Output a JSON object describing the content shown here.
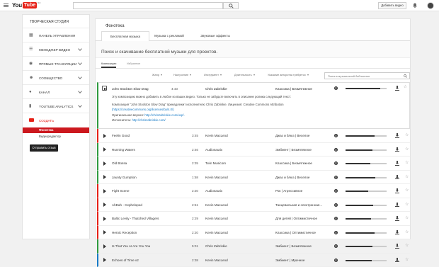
{
  "header": {
    "logo_you": "You",
    "logo_tube": "Tube",
    "logo_locale": "RU",
    "add_video": "Добавить видео"
  },
  "sidebar": {
    "title": "ТВОРЧЕСКАЯ СТУДИЯ",
    "items": [
      {
        "label": "ПАНЕЛЬ УПРАВЛЕНИЯ",
        "icon": "dashboard-icon"
      },
      {
        "label": "МЕНЕДЖЕР ВИДЕО",
        "icon": "video-manager-icon"
      },
      {
        "label": "ПРЯМЫЕ ТРАНСЛЯЦИИ",
        "icon": "live-icon"
      },
      {
        "label": "СООБЩЕСТВО",
        "icon": "community-icon"
      },
      {
        "label": "КАНАЛ",
        "icon": "channel-icon"
      },
      {
        "label": "YOUTUBE ANALYTICS",
        "icon": "analytics-icon"
      }
    ],
    "create": "СОЗДАТЬ",
    "sub_active": "Фонотека",
    "sub_other": "Видеоредактор",
    "feedback": "Отправить отзыв"
  },
  "main": {
    "title": "Фонотека",
    "tabs": [
      "Бесплатная музыка",
      "Музыка с рекламой",
      "Звуковые эффекты"
    ],
    "section_title": "Поиск и скачивание бесплатной музыки для проектов.",
    "subtabs": [
      "Композиции",
      "Избранное"
    ],
    "filters": [
      "Жанр",
      "Настроение",
      "Инструмент",
      "Длительность",
      "Указание авторства требуется"
    ],
    "search_placeholder": "Поиск в музыкальной библиотеке"
  },
  "expanded": {
    "title": "John Stockton Slow Drag",
    "duration": "4:43",
    "artist": "Chris Zabriskie",
    "genre": "Классика | Безмятежное",
    "progress": 0.85,
    "line1": "Эту композицию можно добавить в любое из ваших видео. Только не забудьте включить в описание ролика следующий текст:",
    "line2": "Композиция \"John Stockton Slow Drag\" принадлежит исполнителю Chris Zabriskie. Лицензия: Creative Commons Attribution",
    "line3_link": "(https://creativecommons.org/licenses/by/4.0/)",
    "line4_label": "Оригинальная версия:",
    "line4_link": "http://chriszabriskie.com/uvp/.",
    "line5_label": "Исполнитель:",
    "line5_link": "http://chriszabriskie.com/"
  },
  "rows": [
    {
      "title": "Feelin Good",
      "duration": "3:45",
      "artist": "Kevin MacLeod",
      "genre": "Джаз и блюз | Веселое",
      "accent": "#e62117",
      "progress": 0.7
    },
    {
      "title": "Running Waters",
      "duration": "2:46",
      "artist": "Audionautix",
      "genre": "Эмбиент | Безмятежное",
      "accent": "#2e9a3e",
      "progress": 0.65
    },
    {
      "title": "Old Bossa",
      "duration": "2:35",
      "artist": "Twin Musicom",
      "genre": "Классика | Безмятежное",
      "accent": "#2e9a3e",
      "progress": 0.6
    },
    {
      "title": "Jaunty Gumption",
      "duration": "1:58",
      "artist": "Kevin MacLeod",
      "genre": "Джаз и блюз | Веселое",
      "accent": "#2e9a3e",
      "progress": 0.72
    },
    {
      "title": "Fight Scene",
      "duration": "2:20",
      "artist": "Audionautix",
      "genre": "Рок | Агрессивное",
      "accent": "#e62117",
      "progress": 0.55
    },
    {
      "title": "AhDah - Cephelopod",
      "duration": "2:51",
      "artist": "Kevin MacLeod",
      "genre": "Танцевальная и электронная...",
      "accent": "#e62117",
      "progress": 0.68
    },
    {
      "title": "Baltic Levity - Thatched Villagers",
      "duration": "2:29",
      "artist": "Kevin MacLeod",
      "genre": "Для детей | Оптимистичное",
      "accent": "#e62117",
      "progress": 0.62
    },
    {
      "title": "Heroic Reception",
      "duration": "2:20",
      "artist": "Kevin MacLeod",
      "genre": "Классика | Оптимистичное",
      "accent": "#e62117",
      "progress": 0.7
    },
    {
      "title": "Is That You or Are You You",
      "duration": "5:01",
      "artist": "Chris Zabriskie",
      "genre": "Эмбиент | Безмятежное",
      "accent": "#2e9a3e",
      "progress": 0.66
    },
    {
      "title": "Echoes of Time v2",
      "duration": "2:38",
      "artist": "Kevin MacLeod",
      "genre": "Эмбиент | Мрачное",
      "accent": "#167ac6",
      "progress": 0.64
    }
  ]
}
